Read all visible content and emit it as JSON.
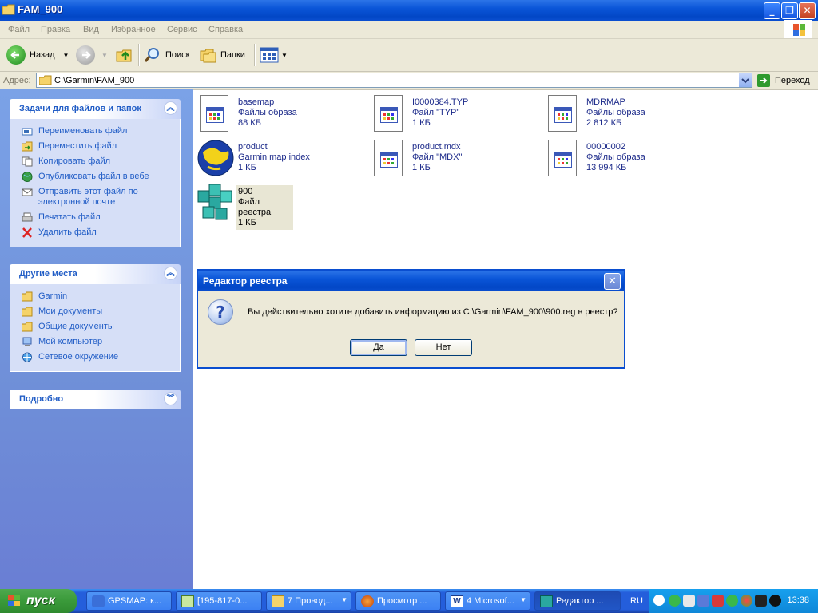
{
  "window": {
    "title": "FAM_900"
  },
  "menu": [
    "Файл",
    "Правка",
    "Вид",
    "Избранное",
    "Сервис",
    "Справка"
  ],
  "toolbar": {
    "back": "Назад",
    "search": "Поиск",
    "folders": "Папки"
  },
  "address": {
    "label": "Адрес:",
    "value": "C:\\Garmin\\FAM_900",
    "go": "Переход"
  },
  "tasks_panel": {
    "title": "Задачи для файлов и папок",
    "items": [
      "Переименовать файл",
      "Переместить файл",
      "Копировать файл",
      "Опубликовать файл в вебе",
      "Отправить этот файл по электронной почте",
      "Печатать файл",
      "Удалить файл"
    ]
  },
  "places_panel": {
    "title": "Другие места",
    "items": [
      "Garmin",
      "Мои документы",
      "Общие документы",
      "Мой компьютер",
      "Сетевое окружение"
    ]
  },
  "details_panel": {
    "title": "Подробно"
  },
  "files": [
    {
      "name": "basemap",
      "type": "Файлы образа",
      "size": "88 КБ"
    },
    {
      "name": "I0000384.TYP",
      "type": "Файл \"TYP\"",
      "size": "1 КБ"
    },
    {
      "name": "MDRMAP",
      "type": "Файлы образа",
      "size": "2 812 КБ"
    },
    {
      "name": "product",
      "type": "Garmin map index",
      "size": "1 КБ"
    },
    {
      "name": "product.mdx",
      "type": "Файл \"MDX\"",
      "size": "1 КБ"
    },
    {
      "name": "00000002",
      "type": "Файлы образа",
      "size": "13 994 КБ"
    },
    {
      "name": "900",
      "type": "Файл реестра",
      "size": "1 КБ"
    }
  ],
  "dialog": {
    "title": "Редактор реестра",
    "message": "Вы действительно хотите добавить информацию из C:\\Garmin\\FAM_900\\900.reg в реестр?",
    "yes": "Да",
    "no": "Нет"
  },
  "taskbar": {
    "start": "пуск",
    "tasks": [
      "GPSMAP: к...",
      "[195-817-0...",
      "7 Провод...",
      "Просмотр ...",
      "4 Microsof...",
      "Редактор ..."
    ],
    "lang": "RU",
    "clock": "13:38"
  },
  "colors": {
    "xp_blue": "#0a55d8",
    "panel_link": "#215dc6",
    "start_green": "#3a9a3a"
  }
}
